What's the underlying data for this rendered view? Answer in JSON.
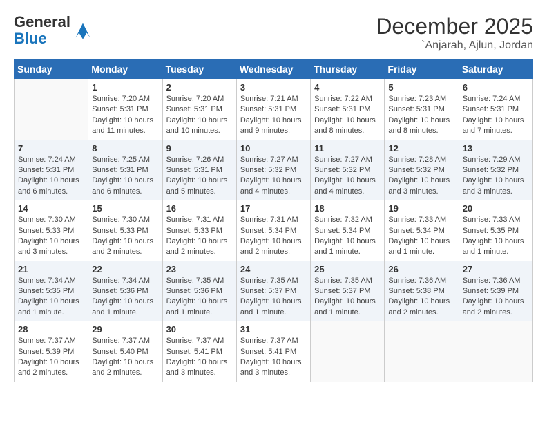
{
  "logo": {
    "general": "General",
    "blue": "Blue"
  },
  "title": "December 2025",
  "subtitle": "`Anjarah, Ajlun, Jordan",
  "days_of_week": [
    "Sunday",
    "Monday",
    "Tuesday",
    "Wednesday",
    "Thursday",
    "Friday",
    "Saturday"
  ],
  "weeks": [
    [
      {
        "day": "",
        "sunrise": "",
        "sunset": "",
        "daylight": ""
      },
      {
        "day": "1",
        "sunrise": "Sunrise: 7:20 AM",
        "sunset": "Sunset: 5:31 PM",
        "daylight": "Daylight: 10 hours and 11 minutes."
      },
      {
        "day": "2",
        "sunrise": "Sunrise: 7:20 AM",
        "sunset": "Sunset: 5:31 PM",
        "daylight": "Daylight: 10 hours and 10 minutes."
      },
      {
        "day": "3",
        "sunrise": "Sunrise: 7:21 AM",
        "sunset": "Sunset: 5:31 PM",
        "daylight": "Daylight: 10 hours and 9 minutes."
      },
      {
        "day": "4",
        "sunrise": "Sunrise: 7:22 AM",
        "sunset": "Sunset: 5:31 PM",
        "daylight": "Daylight: 10 hours and 8 minutes."
      },
      {
        "day": "5",
        "sunrise": "Sunrise: 7:23 AM",
        "sunset": "Sunset: 5:31 PM",
        "daylight": "Daylight: 10 hours and 8 minutes."
      },
      {
        "day": "6",
        "sunrise": "Sunrise: 7:24 AM",
        "sunset": "Sunset: 5:31 PM",
        "daylight": "Daylight: 10 hours and 7 minutes."
      }
    ],
    [
      {
        "day": "7",
        "sunrise": "Sunrise: 7:24 AM",
        "sunset": "Sunset: 5:31 PM",
        "daylight": "Daylight: 10 hours and 6 minutes."
      },
      {
        "day": "8",
        "sunrise": "Sunrise: 7:25 AM",
        "sunset": "Sunset: 5:31 PM",
        "daylight": "Daylight: 10 hours and 6 minutes."
      },
      {
        "day": "9",
        "sunrise": "Sunrise: 7:26 AM",
        "sunset": "Sunset: 5:31 PM",
        "daylight": "Daylight: 10 hours and 5 minutes."
      },
      {
        "day": "10",
        "sunrise": "Sunrise: 7:27 AM",
        "sunset": "Sunset: 5:32 PM",
        "daylight": "Daylight: 10 hours and 4 minutes."
      },
      {
        "day": "11",
        "sunrise": "Sunrise: 7:27 AM",
        "sunset": "Sunset: 5:32 PM",
        "daylight": "Daylight: 10 hours and 4 minutes."
      },
      {
        "day": "12",
        "sunrise": "Sunrise: 7:28 AM",
        "sunset": "Sunset: 5:32 PM",
        "daylight": "Daylight: 10 hours and 3 minutes."
      },
      {
        "day": "13",
        "sunrise": "Sunrise: 7:29 AM",
        "sunset": "Sunset: 5:32 PM",
        "daylight": "Daylight: 10 hours and 3 minutes."
      }
    ],
    [
      {
        "day": "14",
        "sunrise": "Sunrise: 7:30 AM",
        "sunset": "Sunset: 5:33 PM",
        "daylight": "Daylight: 10 hours and 3 minutes."
      },
      {
        "day": "15",
        "sunrise": "Sunrise: 7:30 AM",
        "sunset": "Sunset: 5:33 PM",
        "daylight": "Daylight: 10 hours and 2 minutes."
      },
      {
        "day": "16",
        "sunrise": "Sunrise: 7:31 AM",
        "sunset": "Sunset: 5:33 PM",
        "daylight": "Daylight: 10 hours and 2 minutes."
      },
      {
        "day": "17",
        "sunrise": "Sunrise: 7:31 AM",
        "sunset": "Sunset: 5:34 PM",
        "daylight": "Daylight: 10 hours and 2 minutes."
      },
      {
        "day": "18",
        "sunrise": "Sunrise: 7:32 AM",
        "sunset": "Sunset: 5:34 PM",
        "daylight": "Daylight: 10 hours and 1 minute."
      },
      {
        "day": "19",
        "sunrise": "Sunrise: 7:33 AM",
        "sunset": "Sunset: 5:34 PM",
        "daylight": "Daylight: 10 hours and 1 minute."
      },
      {
        "day": "20",
        "sunrise": "Sunrise: 7:33 AM",
        "sunset": "Sunset: 5:35 PM",
        "daylight": "Daylight: 10 hours and 1 minute."
      }
    ],
    [
      {
        "day": "21",
        "sunrise": "Sunrise: 7:34 AM",
        "sunset": "Sunset: 5:35 PM",
        "daylight": "Daylight: 10 hours and 1 minute."
      },
      {
        "day": "22",
        "sunrise": "Sunrise: 7:34 AM",
        "sunset": "Sunset: 5:36 PM",
        "daylight": "Daylight: 10 hours and 1 minute."
      },
      {
        "day": "23",
        "sunrise": "Sunrise: 7:35 AM",
        "sunset": "Sunset: 5:36 PM",
        "daylight": "Daylight: 10 hours and 1 minute."
      },
      {
        "day": "24",
        "sunrise": "Sunrise: 7:35 AM",
        "sunset": "Sunset: 5:37 PM",
        "daylight": "Daylight: 10 hours and 1 minute."
      },
      {
        "day": "25",
        "sunrise": "Sunrise: 7:35 AM",
        "sunset": "Sunset: 5:37 PM",
        "daylight": "Daylight: 10 hours and 1 minute."
      },
      {
        "day": "26",
        "sunrise": "Sunrise: 7:36 AM",
        "sunset": "Sunset: 5:38 PM",
        "daylight": "Daylight: 10 hours and 2 minutes."
      },
      {
        "day": "27",
        "sunrise": "Sunrise: 7:36 AM",
        "sunset": "Sunset: 5:39 PM",
        "daylight": "Daylight: 10 hours and 2 minutes."
      }
    ],
    [
      {
        "day": "28",
        "sunrise": "Sunrise: 7:37 AM",
        "sunset": "Sunset: 5:39 PM",
        "daylight": "Daylight: 10 hours and 2 minutes."
      },
      {
        "day": "29",
        "sunrise": "Sunrise: 7:37 AM",
        "sunset": "Sunset: 5:40 PM",
        "daylight": "Daylight: 10 hours and 2 minutes."
      },
      {
        "day": "30",
        "sunrise": "Sunrise: 7:37 AM",
        "sunset": "Sunset: 5:41 PM",
        "daylight": "Daylight: 10 hours and 3 minutes."
      },
      {
        "day": "31",
        "sunrise": "Sunrise: 7:37 AM",
        "sunset": "Sunset: 5:41 PM",
        "daylight": "Daylight: 10 hours and 3 minutes."
      },
      {
        "day": "",
        "sunrise": "",
        "sunset": "",
        "daylight": ""
      },
      {
        "day": "",
        "sunrise": "",
        "sunset": "",
        "daylight": ""
      },
      {
        "day": "",
        "sunrise": "",
        "sunset": "",
        "daylight": ""
      }
    ]
  ]
}
